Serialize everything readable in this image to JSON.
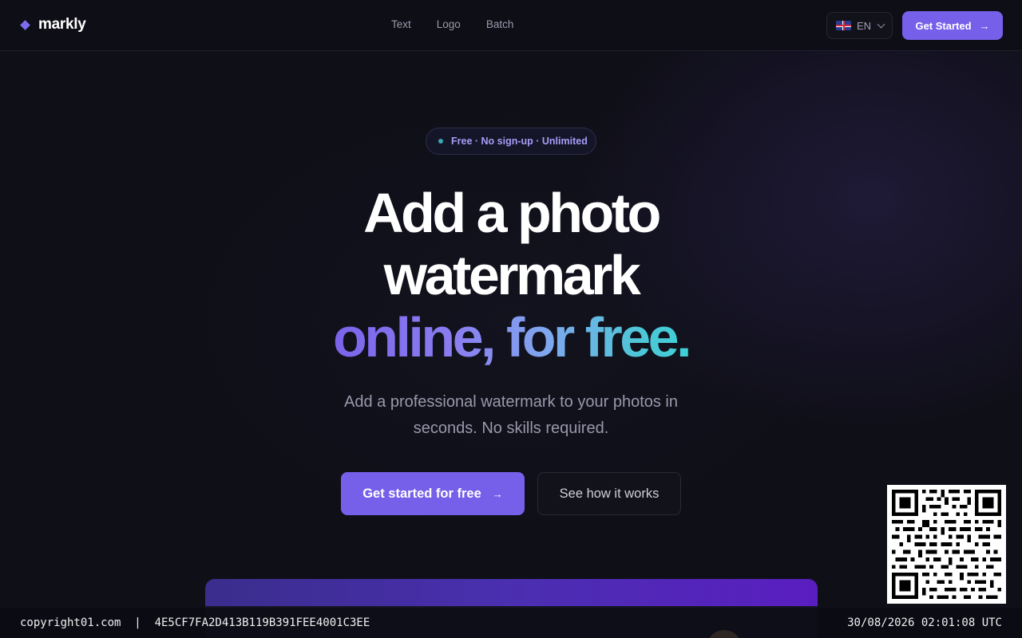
{
  "header": {
    "logo_text": "markly",
    "nav": [
      "Text",
      "Logo",
      "Batch"
    ],
    "language": "EN",
    "cta_label": "Get Started"
  },
  "hero": {
    "badge": "Free · No sign-up · Unlimited",
    "title_line1": "Add a photo",
    "title_line2": "watermark",
    "title_line3": "online, for free.",
    "subtitle": "Add a professional watermark to your photos in seconds. No skills required.",
    "primary_button": "Get started for free",
    "secondary_button": "See how it works"
  },
  "watermark": {
    "left": "copyright01.com  |  4E5CF7FA2D413B119B391FEE4001C3EE",
    "right": "30/08/2026 02:01:08 UTC"
  },
  "colors": {
    "accent": "#7660ea",
    "background": "#0f0f18",
    "gradient_start": "#7b63ea",
    "gradient_end": "#3ed0d6"
  },
  "icons": [
    "logo-diamond-icon",
    "uk-flag-icon",
    "chevron-down-icon",
    "arrow-right-icon",
    "qr-code-icon"
  ]
}
